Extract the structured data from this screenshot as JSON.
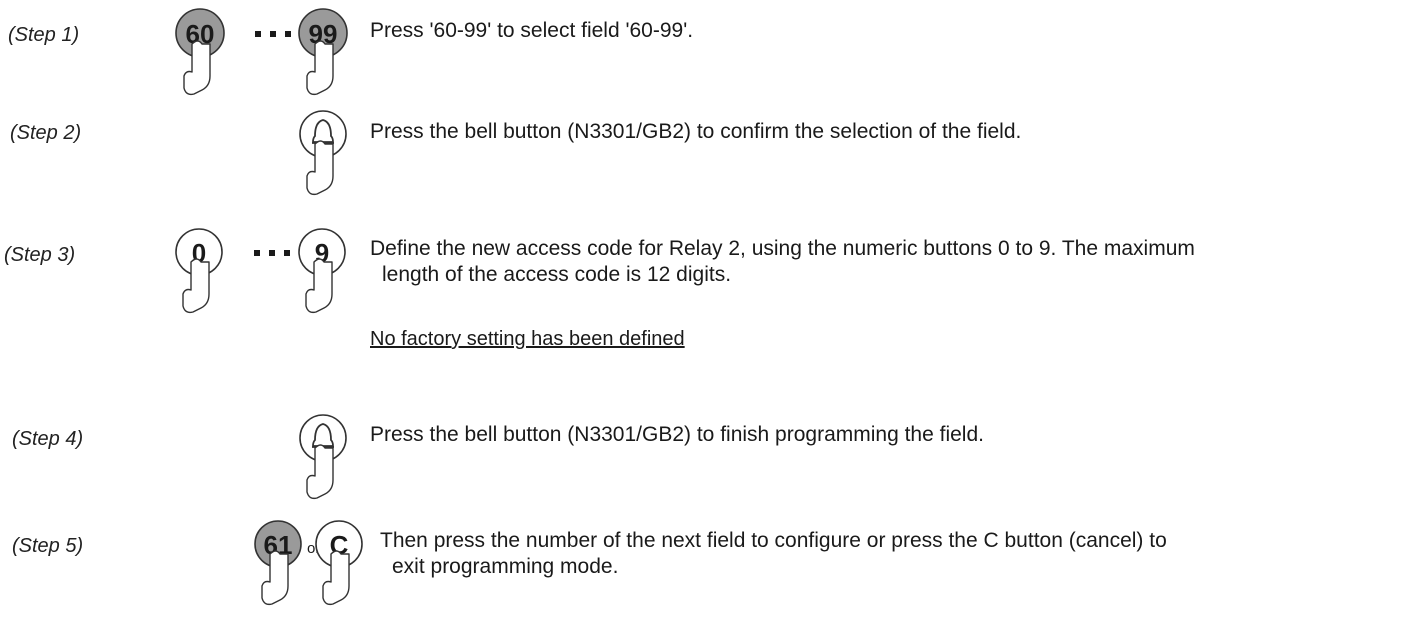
{
  "steps": [
    {
      "label": "(Step 1)",
      "buttons": [
        "60",
        "99"
      ],
      "connector": "dots",
      "text": "Press '60-99' to select field '60-99'."
    },
    {
      "label": "(Step 2)",
      "buttons": [
        "bell-icon"
      ],
      "text": "Press the bell button (N3301/GB2) to confirm the selection of the field."
    },
    {
      "label": "(Step 3)",
      "buttons": [
        "0",
        "9"
      ],
      "connector": "dots",
      "text_line1": "Define the new access code for Relay 2, using the numeric buttons 0 to 9. The maximum",
      "text_line2": "length of the access code is 12 digits.",
      "note": "No factory setting has been defined"
    },
    {
      "label": "(Step 4)",
      "buttons": [
        "bell-icon"
      ],
      "text": "Press the bell button (N3301/GB2) to finish programming the field."
    },
    {
      "label": "(Step 5)",
      "buttons": [
        "61",
        "C"
      ],
      "connector": "or",
      "connector_text": "or",
      "text_line1": "Then press the number of the next field to configure or press the C button (cancel) to",
      "text_line2": "exit programming mode."
    }
  ],
  "colors": {
    "gray_button": "#9a9a9a",
    "text": "#1a1a1a"
  }
}
